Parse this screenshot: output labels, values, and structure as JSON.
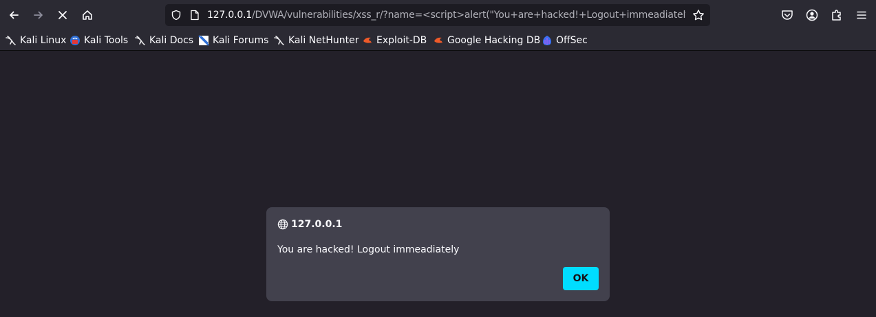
{
  "browser": {
    "url_host": "127.0.0.1",
    "url_path": "/DVWA/vulnerabilities/xss_r/?name=<script>alert(\"You+are+hacked!+Logout+immeadiately\")",
    "icons": {
      "back": "arrow-left-icon",
      "forward": "arrow-right-icon",
      "stop": "close-icon",
      "home": "home-icon",
      "tracking": "shield-icon",
      "page": "page-icon",
      "bookmark": "star-icon",
      "pocket": "pocket-icon",
      "account": "account-icon",
      "extensions": "puzzle-icon",
      "menu": "hamburger-menu-icon"
    }
  },
  "bookmarks": [
    {
      "label": "Kali Linux",
      "icon": "kali-dragon-icon"
    },
    {
      "label": "Kali Tools",
      "icon": "kali-tools-icon"
    },
    {
      "label": "Kali Docs",
      "icon": "kali-dragon-icon"
    },
    {
      "label": "Kali Forums",
      "icon": "kali-forums-icon"
    },
    {
      "label": "Kali NetHunter",
      "icon": "kali-dragon-icon"
    },
    {
      "label": "Exploit-DB",
      "icon": "exploit-db-icon"
    },
    {
      "label": "Google Hacking DB",
      "icon": "exploit-db-icon"
    },
    {
      "label": "OffSec",
      "icon": "offsec-icon"
    }
  ],
  "dialog": {
    "origin": "127.0.0.1",
    "message": "You are hacked! Logout immeadiately",
    "ok_label": "OK"
  },
  "colors": {
    "toolbar": "#2b2a33",
    "content_bg": "#232029",
    "dialog_bg": "#42414d",
    "accent": "#00ddff"
  }
}
